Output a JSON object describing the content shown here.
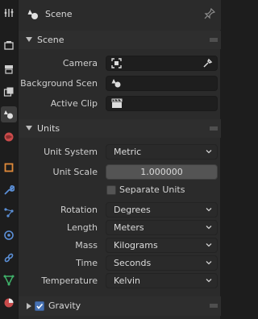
{
  "header": {
    "title": "Scene"
  },
  "sections": {
    "scene": {
      "label": "Scene"
    },
    "units": {
      "label": "Units"
    },
    "gravity": {
      "label": "Gravity"
    }
  },
  "scene": {
    "camera_label": "Camera",
    "background_label": "Background Scen",
    "clip_label": "Active Clip"
  },
  "units": {
    "system_label": "Unit System",
    "system_value": "Metric",
    "scale_label": "Unit Scale",
    "scale_value": "1.000000",
    "separate_label": "Separate Units",
    "separate_checked": false,
    "rotation_label": "Rotation",
    "rotation_value": "Degrees",
    "length_label": "Length",
    "length_value": "Meters",
    "mass_label": "Mass",
    "mass_value": "Kilograms",
    "time_label": "Time",
    "time_value": "Seconds",
    "temperature_label": "Temperature",
    "temperature_value": "Kelvin"
  },
  "gravity": {
    "enabled": true
  },
  "tabs": [
    "tool-icon",
    "render-icon",
    "output-icon",
    "view-layer-icon",
    "scene-icon",
    "world-icon",
    "object-icon",
    "modifier-icon",
    "particles-icon",
    "physics-icon",
    "constraints-icon",
    "data-icon",
    "material-icon"
  ],
  "colors": {
    "accent": "#4772b3",
    "panel": "#2b2b2b",
    "field": "#1e1e1e"
  }
}
